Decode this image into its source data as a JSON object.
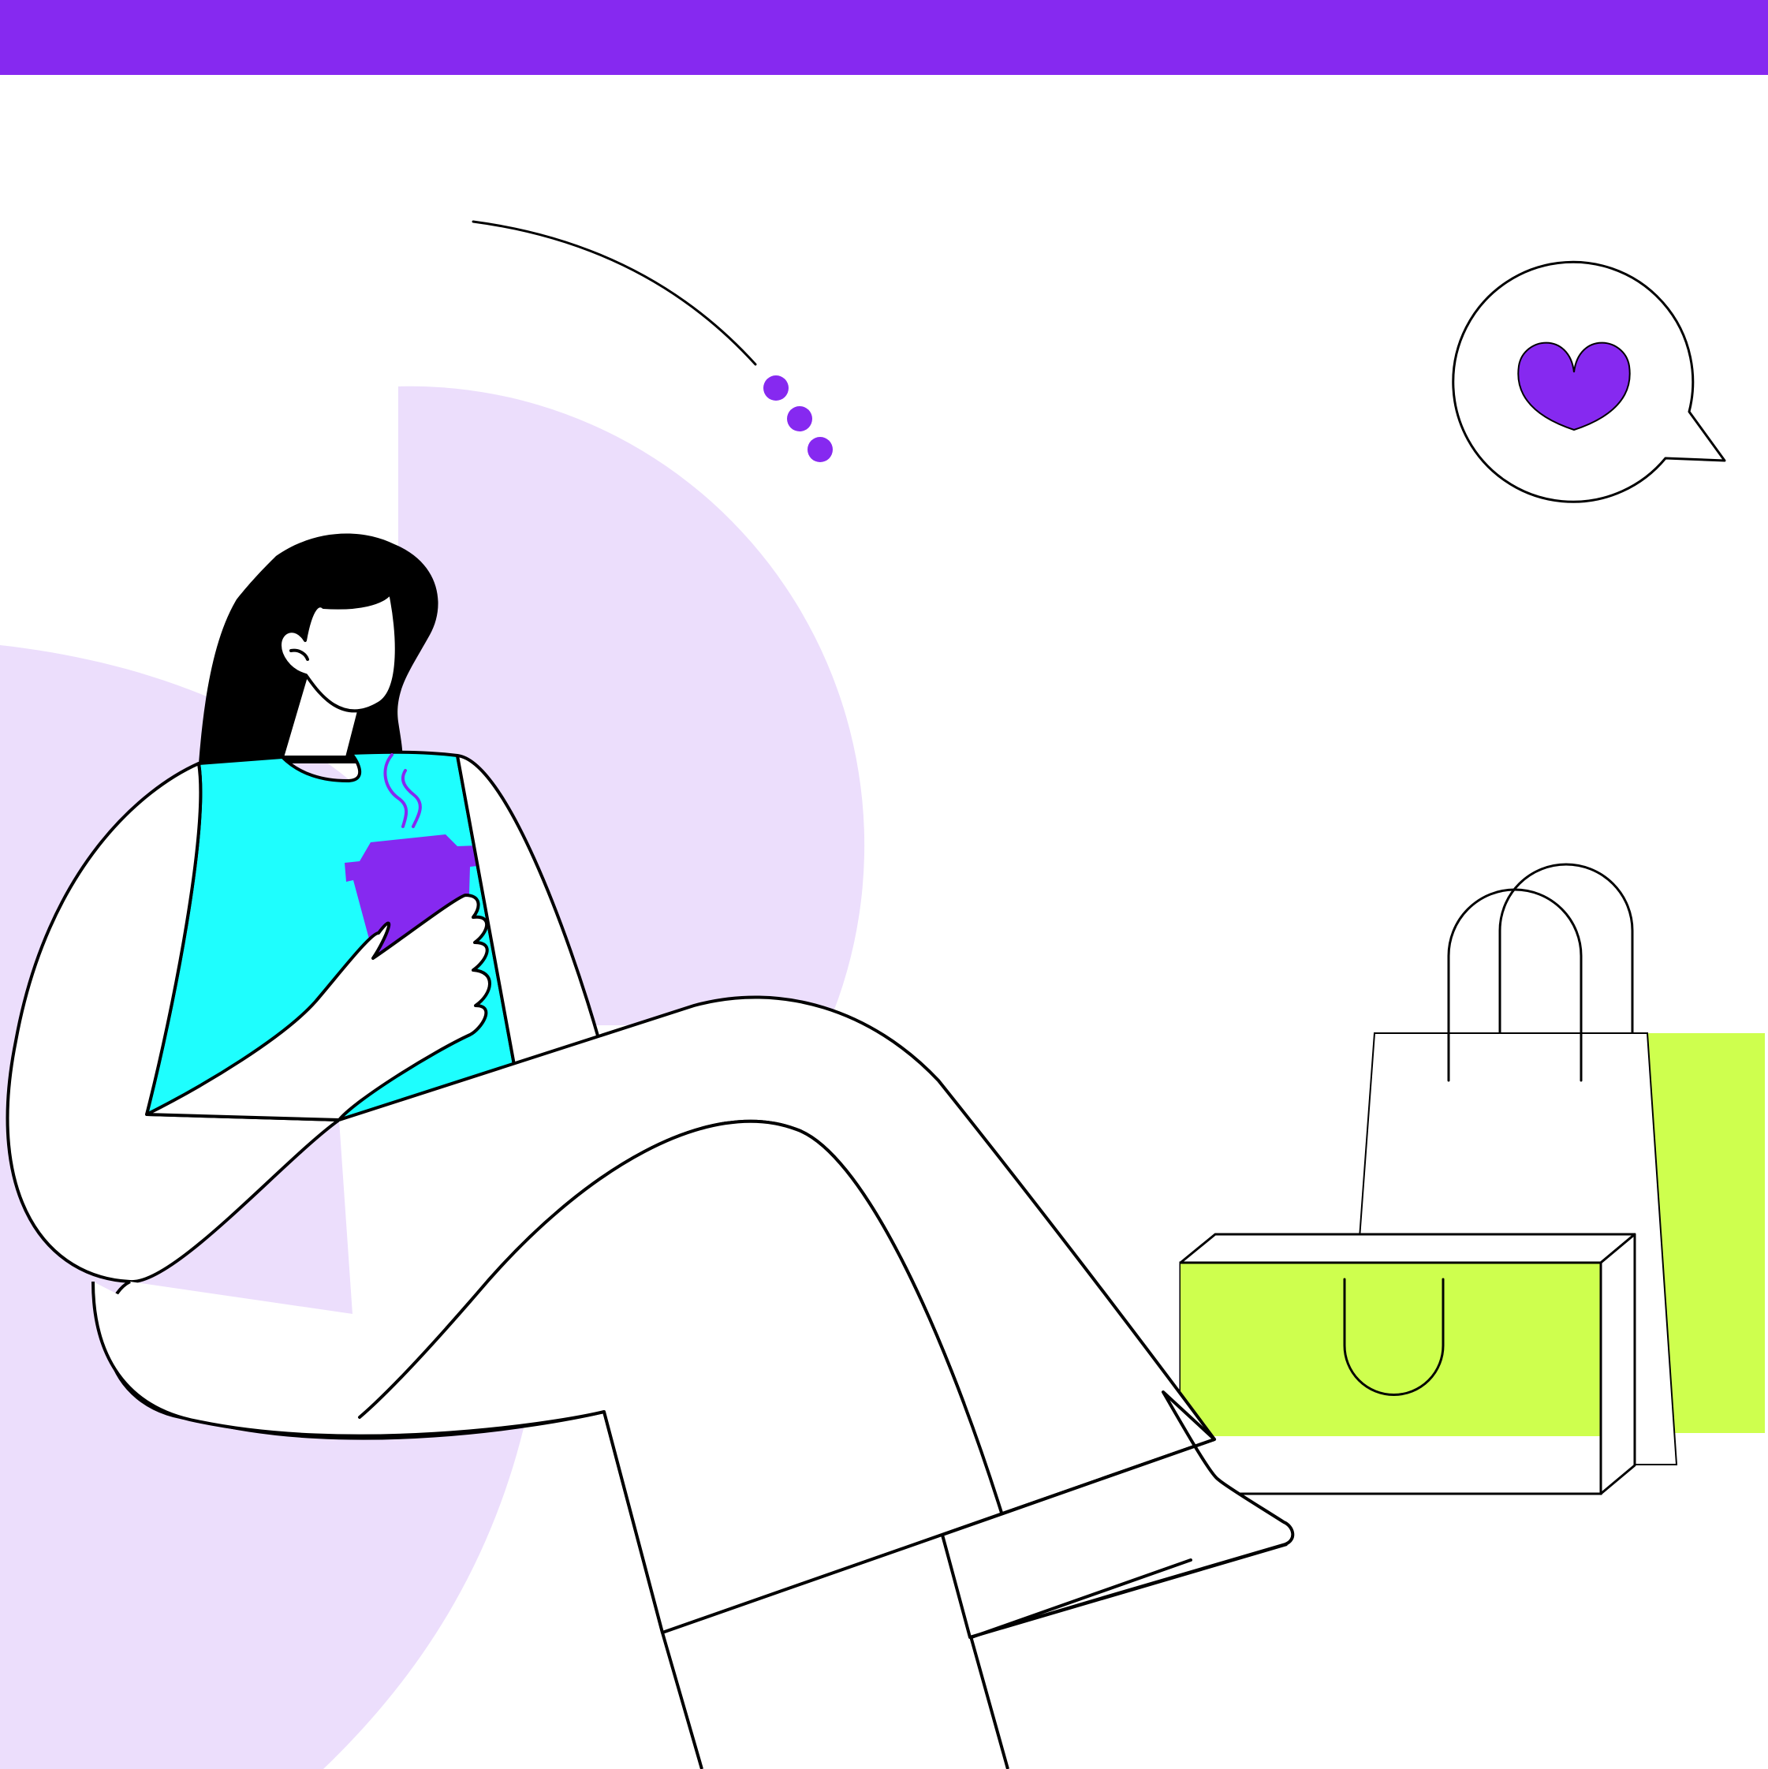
{
  "scene": {
    "subject": "woman-with-coffee",
    "icons": [
      "heart-icon",
      "speech-bubble-icon",
      "shopping-bag-icon",
      "gift-box-icon",
      "coffee-cup-icon"
    ]
  },
  "colors": {
    "background": "#ffffff",
    "top_bar": "#8629f0",
    "accent_purple": "#8629f0",
    "lavender": "#ecdefc",
    "shirt_cyan": "#1efefe",
    "lime": "#ceff4e",
    "outline": "#000000",
    "fill_white": "#ffffff"
  }
}
